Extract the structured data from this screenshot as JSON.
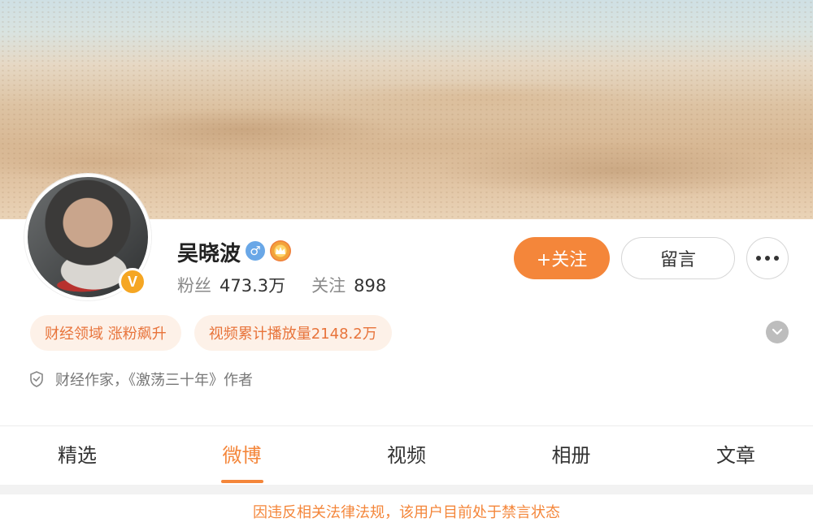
{
  "profile": {
    "name": "吴晓波",
    "gender_symbol": "♂",
    "verified_symbol": "V",
    "fans_label": "粉丝",
    "fans_count": "473.3万",
    "following_label": "关注",
    "following_count": "898"
  },
  "actions": {
    "follow_label": "+关注",
    "message_label": "留言"
  },
  "tags": [
    "财经领域 涨粉飙升",
    "视频累计播放量2148.2万"
  ],
  "bio": "财经作家，《激荡三十年》作者",
  "tabs": [
    {
      "label": "精选",
      "active": false
    },
    {
      "label": "微博",
      "active": true
    },
    {
      "label": "视频",
      "active": false
    },
    {
      "label": "相册",
      "active": false
    },
    {
      "label": "文章",
      "active": false
    }
  ],
  "notice": "因违反相关法律法规，该用户目前处于禁言状态",
  "colors": {
    "accent": "#f4863a",
    "tag_bg": "#fdf1e8",
    "verified": "#f5a623",
    "gender": "#69a7e7"
  }
}
